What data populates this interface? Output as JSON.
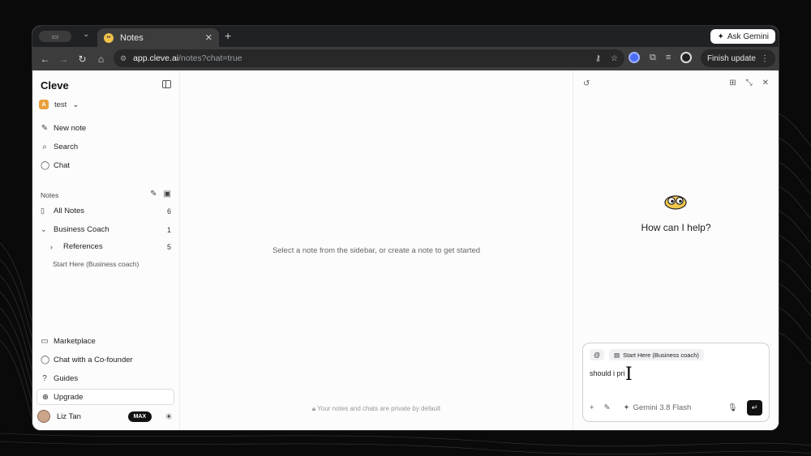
{
  "browser": {
    "tab_title": "Notes",
    "ask_gemini": "Ask Gemini",
    "url_host": "app.cleve.ai",
    "url_path": "/notes?chat=true",
    "finish_update": "Finish update"
  },
  "sidebar": {
    "brand": "Cleve",
    "workspace": "test",
    "workspace_initial": "A",
    "nav": {
      "new_note": "New note",
      "search": "Search",
      "chat": "Chat"
    },
    "notes_section": "Notes",
    "all_notes": {
      "label": "All Notes",
      "count": "6"
    },
    "business_coach": {
      "label": "Business Coach",
      "count": "1"
    },
    "references": {
      "label": "References",
      "count": "5"
    },
    "start_here": "Start Here (Business coach)",
    "marketplace": "Marketplace",
    "cofounder": "Chat with a Co-founder",
    "guides": "Guides",
    "upgrade": "Upgrade",
    "user": {
      "name": "Liz Tan",
      "badge": "MAX"
    }
  },
  "main": {
    "empty_message": "Select a note from the sidebar, or create a note to get started",
    "privacy": "Your notes and chats are private by default"
  },
  "chat": {
    "prompt": "How can I help?",
    "at": "@",
    "context_chip": "Start Here (Business coach)",
    "input_text": "should i pri",
    "model": "Gemini 3.8 Flash"
  }
}
